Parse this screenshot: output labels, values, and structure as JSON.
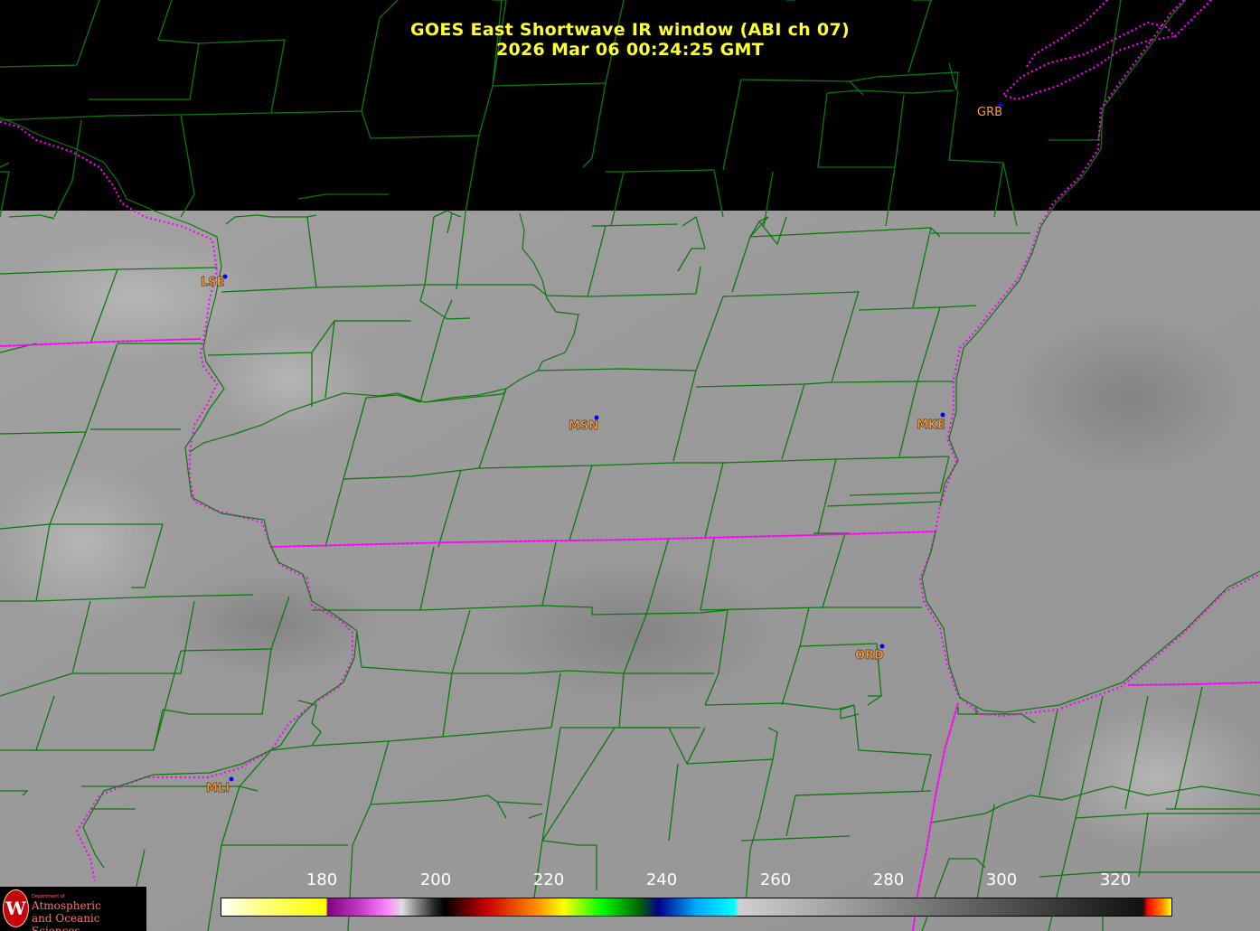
{
  "title": {
    "line1": "GOES East Shortwave IR window (ABI ch 07)",
    "line2": "2026 Mar 06  00:24:25 GMT"
  },
  "stations": [
    {
      "id": "GRB",
      "name": "GRB",
      "region": "night"
    },
    {
      "id": "LSE",
      "name": "LSE",
      "region": "day"
    },
    {
      "id": "MSN",
      "name": "MSN",
      "region": "day"
    },
    {
      "id": "MKE",
      "name": "MKE",
      "region": "day"
    },
    {
      "id": "ORD",
      "name": "ORD",
      "region": "day"
    },
    {
      "id": "MLI",
      "name": "MLI",
      "region": "day"
    }
  ],
  "colorbar": {
    "tick_labels": [
      "180",
      "200",
      "220",
      "240",
      "260",
      "280",
      "300",
      "320"
    ],
    "stops": [
      {
        "t": 0.0,
        "color": "#ffffff"
      },
      {
        "t": 0.04,
        "color": "#ffff88"
      },
      {
        "t": 0.11,
        "color": "#ffff00"
      },
      {
        "t": 0.112,
        "color": "#800080"
      },
      {
        "t": 0.15,
        "color": "#cc44cc"
      },
      {
        "t": 0.175,
        "color": "#ff88ff"
      },
      {
        "t": 0.19,
        "color": "#dddddd"
      },
      {
        "t": 0.225,
        "color": "#222222"
      },
      {
        "t": 0.235,
        "color": "#000000"
      },
      {
        "t": 0.28,
        "color": "#cc0000"
      },
      {
        "t": 0.33,
        "color": "#ff8800"
      },
      {
        "t": 0.36,
        "color": "#ffff00"
      },
      {
        "t": 0.4,
        "color": "#00ff00"
      },
      {
        "t": 0.44,
        "color": "#006600"
      },
      {
        "t": 0.46,
        "color": "#000088"
      },
      {
        "t": 0.5,
        "color": "#00aaff"
      },
      {
        "t": 0.54,
        "color": "#00ffff"
      },
      {
        "t": 0.545,
        "color": "#d0d0d0"
      },
      {
        "t": 0.97,
        "color": "#101010"
      },
      {
        "t": 0.975,
        "color": "#ff0000"
      },
      {
        "t": 0.99,
        "color": "#ff8800"
      },
      {
        "t": 1.0,
        "color": "#ffff00"
      }
    ]
  },
  "colors": {
    "county_lines": "#0a7a0a",
    "state_lines": "#ff00ff",
    "station_label": "#ff9933",
    "station_dot": "#0000ff",
    "title": "#ffff33"
  },
  "logo": {
    "dept_line": "Department of",
    "line1": "Atmospheric",
    "line2": "and Oceanic Sciences",
    "shield_letter": "W"
  }
}
